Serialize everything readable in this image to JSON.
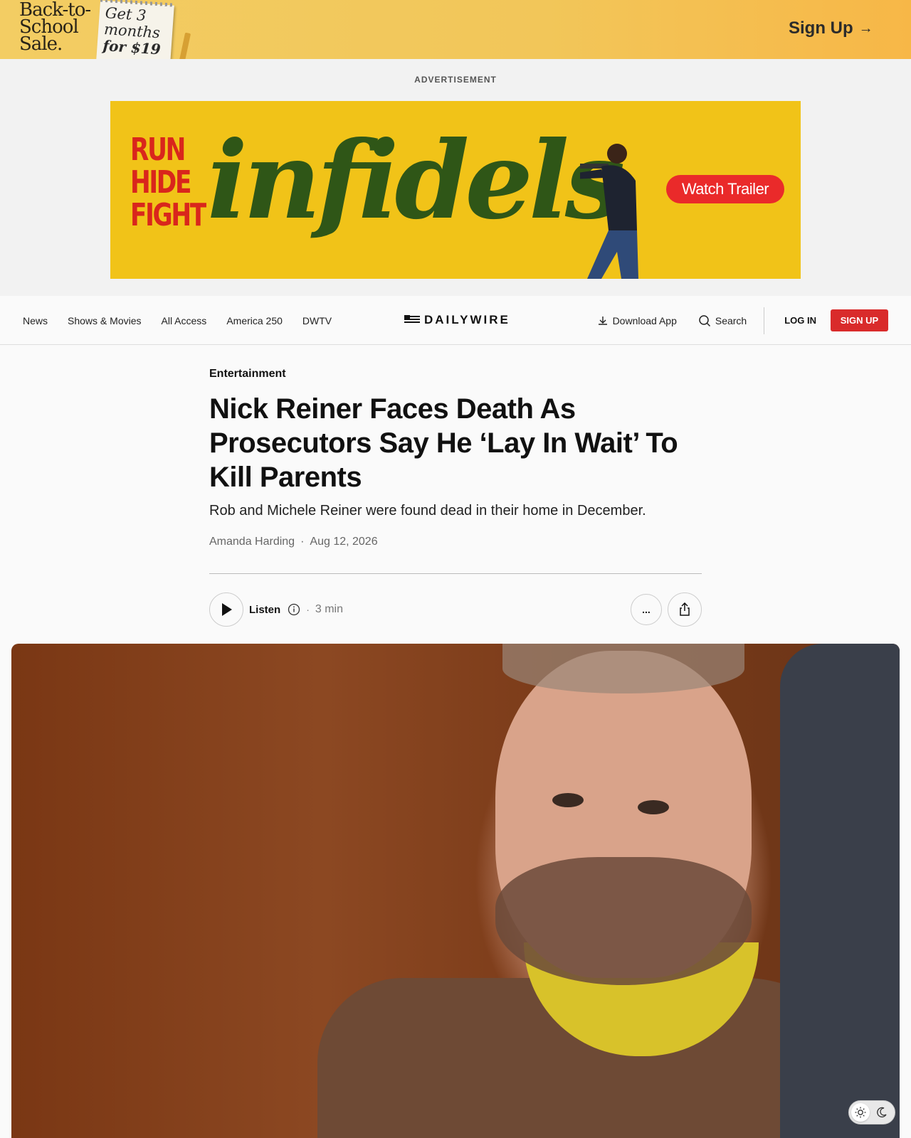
{
  "promo": {
    "logo_line1": "Back-to-",
    "logo_line2": "School",
    "logo_line3": "Sale.",
    "note_line1": "Get 3",
    "note_line2": "months",
    "note_line3": "for $19",
    "signup_label": "Sign Up",
    "signup_arrow": "→"
  },
  "ad": {
    "label": "ADVERTISEMENT",
    "tagline_1": "RUN",
    "tagline_2": "HIDE",
    "tagline_3": "FIGHT",
    "title": "infidels",
    "cta": "Watch Trailer"
  },
  "nav": {
    "links": [
      "News",
      "Shows & Movies",
      "All Access",
      "America 250",
      "DWTV"
    ],
    "brand": "DAILYWIRE",
    "download": "Download App",
    "search": "Search",
    "login": "LOG IN",
    "signup": "SIGN UP"
  },
  "article": {
    "category": "Entertainment",
    "headline": "Nick Reiner Faces Death As Prosecutors Say He ‘Lay In Wait’ To Kill Parents",
    "dek": "Rob and Michele Reiner were found dead in their home in December.",
    "author": "Amanda Harding",
    "separator": "·",
    "date": "Aug 12, 2026",
    "listen_label": "Listen",
    "duration": "3 min",
    "more_label": "..."
  },
  "colors": {
    "accent_red": "#d92b2b",
    "promo_yellow": "#f3cd63",
    "ad_yellow": "#f1c318",
    "ad_green": "#2f5617"
  }
}
